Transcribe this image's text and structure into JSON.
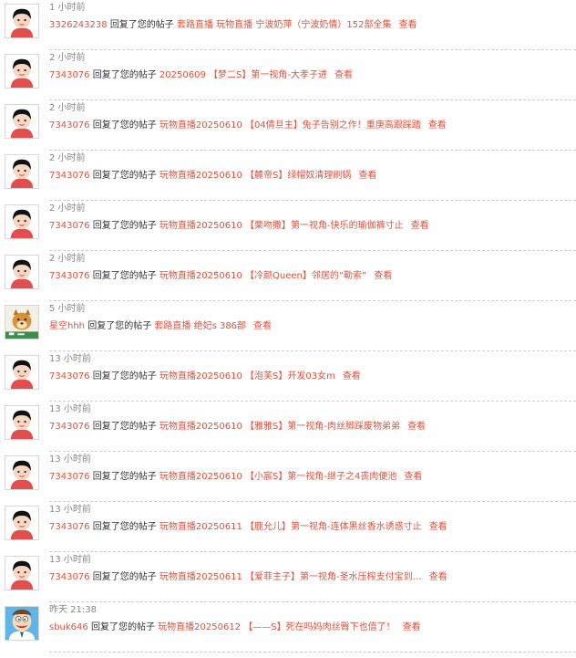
{
  "notifications": [
    {
      "time": "1 小时前",
      "user": "3326243238",
      "action": "回复了您的帖子",
      "post": "套路直播 玩物直播 宁波奶萍（宁波奶情）152部全集",
      "view": "查看",
      "avatar": "default-avatar"
    },
    {
      "time": "2 小时前",
      "user": "7343076",
      "action": "回复了您的帖子",
      "post": "20250609 【梦二S】第一视角-大孝子进",
      "view": "查看",
      "avatar": "default-avatar"
    },
    {
      "time": "2 小时前",
      "user": "7343076",
      "action": "回复了您的帖子",
      "post": "玩物直播20250610 【04倩旦主】兔子告别之作！重庚高跟踩踏",
      "view": "查看",
      "avatar": "default-avatar"
    },
    {
      "time": "2 小时前",
      "user": "7343076",
      "action": "回复了您的帖子",
      "post": "玩物直播20250610 【麓帝S】绿帽奴清理刷锅",
      "view": "查看",
      "avatar": "default-avatar"
    },
    {
      "time": "2 小时前",
      "user": "7343076",
      "action": "回复了您的帖子",
      "post": "玩物直播20250610 【栗吻撒】第一视角-快乐的瑜伽裤寸止",
      "view": "查看",
      "avatar": "default-avatar"
    },
    {
      "time": "2 小时前",
      "user": "7343076",
      "action": "回复了您的帖子",
      "post": "玩物直播20250610 【冷颜Queen】邻居的“勒索”",
      "view": "查看",
      "avatar": "default-avatar"
    },
    {
      "time": "5 小时前",
      "user": "星空hhh",
      "action": "回复了您的帖子",
      "post": "套路直播 绝妃s 386部",
      "view": "查看",
      "avatar": "dog-avatar"
    },
    {
      "time": "13 小时前",
      "user": "7343076",
      "action": "回复了您的帖子",
      "post": "玩物直播20250610 【泡芙S】开发03女m",
      "view": "查看",
      "avatar": "default-avatar"
    },
    {
      "time": "13 小时前",
      "user": "7343076",
      "action": "回复了您的帖子",
      "post": "玩物直播20250610 【雅雅S】第一视角-肉丝脚踩废物弟弟",
      "view": "查看",
      "avatar": "default-avatar"
    },
    {
      "time": "13 小时前",
      "user": "7343076",
      "action": "回复了您的帖子",
      "post": "玩物直播20250610 【小宸S】第一视角-继子之4丧肉便池",
      "view": "查看",
      "avatar": "default-avatar"
    },
    {
      "time": "13 小时前",
      "user": "7343076",
      "action": "回复了您的帖子",
      "post": "玩物直播20250611 【鹿允儿】第一视角-连体黑丝香水诱惑寸止",
      "view": "查看",
      "avatar": "default-avatar"
    },
    {
      "time": "13 小时前",
      "user": "7343076",
      "action": "回复了您的帖子",
      "post": "玩物直播20250611 【爱菲主子】第一视角-圣水压榨支付宝到…",
      "view": "查看",
      "avatar": "default-avatar"
    },
    {
      "time": "昨天 21:38",
      "user": "sbuk646",
      "action": "回复了您的帖子",
      "post": "玩物直播20250612 【——S】死在吗妈肉丝臀下也值了！",
      "view": "查看",
      "avatar": "cartoon-avatar"
    }
  ],
  "colors": {
    "link": "#e2513c",
    "time": "#888888",
    "text": "#333333",
    "divider": "#cfcfcf"
  }
}
